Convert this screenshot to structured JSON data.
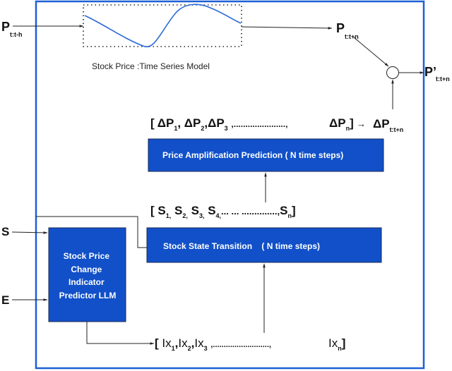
{
  "colors": {
    "frame": "#1f5fd6",
    "box_fill": "#1150c8",
    "box_stroke": "#1a2a55",
    "curve": "#2a6ad8",
    "line": "#222222"
  },
  "inputs": {
    "price_history": {
      "main": "P",
      "sub": "t:t-h"
    },
    "s_input": "S",
    "e_input": "E"
  },
  "time_series": {
    "caption": "Stock Price :Time Series Model"
  },
  "outputs": {
    "price_forecast": {
      "main": "P",
      "sub": "t:t+n"
    },
    "final_forecast": {
      "main": "P’",
      "sub": "t:t+n"
    },
    "delta_total": {
      "main": "ΔP",
      "sub": "t:t+n"
    }
  },
  "sequences": {
    "delta_p": {
      "open": "[",
      "items": [
        {
          "main": "ΔP",
          "sub": "1"
        },
        {
          "main": "ΔP",
          "sub": "2"
        },
        {
          "main": "ΔP",
          "sub": "3"
        }
      ],
      "ellipsis": ",......................,",
      "last": {
        "main": "ΔP",
        "sub": "n"
      },
      "close": "]",
      "arrow": "→"
    },
    "states": {
      "open": "[",
      "items": [
        {
          "main": "S",
          "sub": "1,"
        },
        {
          "main": "S",
          "sub": "2,"
        },
        {
          "main": "S",
          "sub": "3,"
        },
        {
          "main": "S",
          "sub": "4,"
        }
      ],
      "ellipsis": "...  ... ..............,",
      "last": {
        "main": "S",
        "sub": "n"
      },
      "close": "]"
    },
    "indicators": {
      "open": "[",
      "items": [
        {
          "main": "Ix",
          "sub": "1"
        },
        {
          "main": "Ix",
          "sub": "2"
        },
        {
          "main": "Ix",
          "sub": "3"
        }
      ],
      "ellipsis": ",..........................,",
      "last": {
        "main": "Ix",
        "sub": "n"
      },
      "close": "]"
    }
  },
  "boxes": {
    "amplification": "Price Amplification Prediction ( N time steps)",
    "state_transition": "Stock State Transition    ( N time steps)",
    "llm": [
      "Stock Price",
      "Change",
      "Indicator",
      "Predictor LLM"
    ]
  }
}
